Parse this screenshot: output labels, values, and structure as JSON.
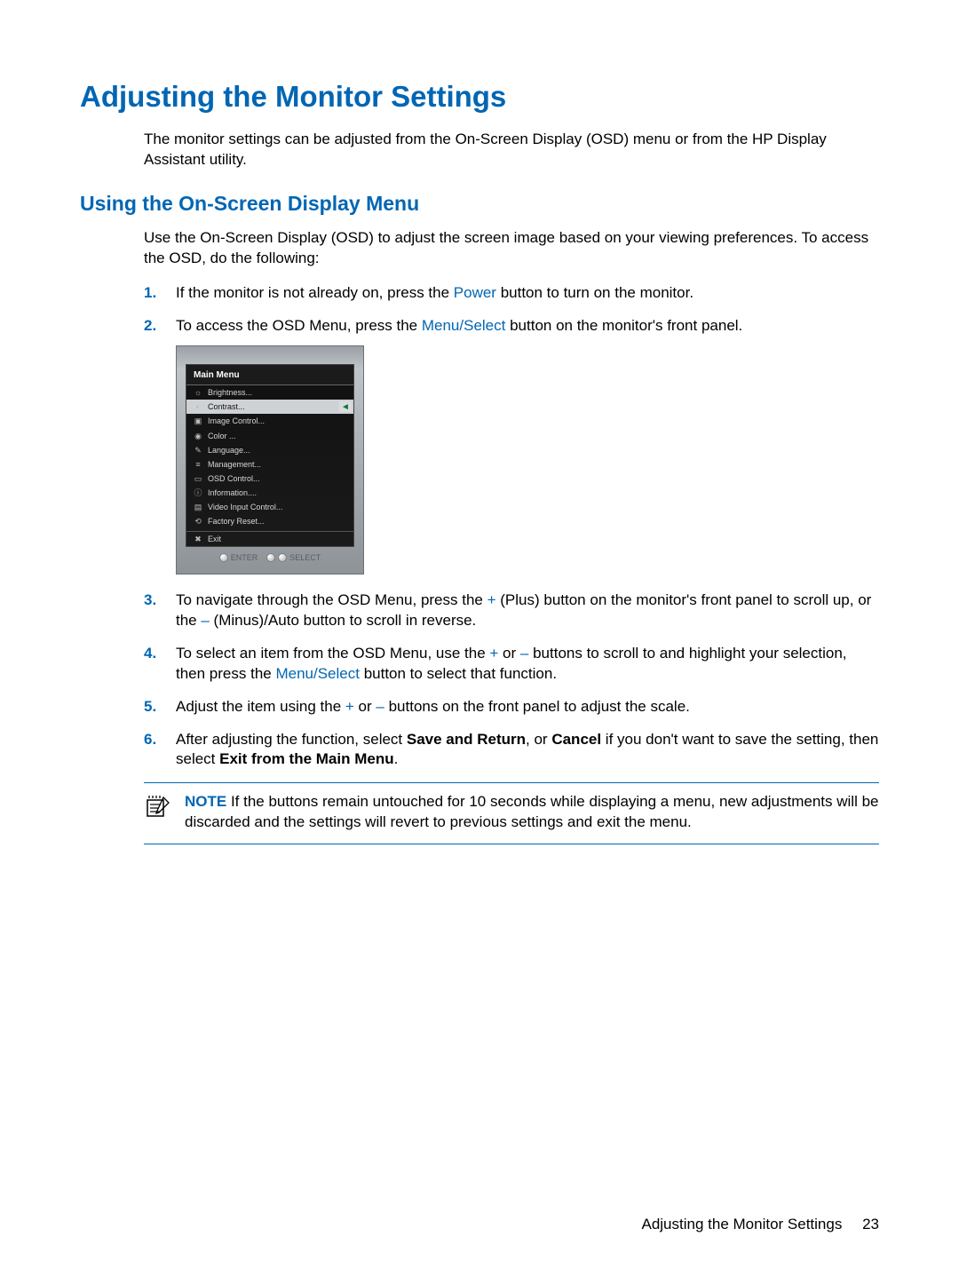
{
  "title": "Adjusting the Monitor Settings",
  "intro": "The monitor settings can be adjusted from the On-Screen Display (OSD) menu or from the HP Display Assistant utility.",
  "subheading": "Using the On-Screen Display Menu",
  "subintro": "Use the On-Screen Display (OSD) to adjust the screen image based on your viewing preferences. To access the OSD, do the following:",
  "steps": {
    "s1": {
      "num": "1.",
      "pre": "If the monitor is not already on, press the ",
      "hl": "Power",
      "post": " button to turn on the monitor."
    },
    "s2": {
      "num": "2.",
      "pre": "To access the OSD Menu, press the ",
      "hl": "Menu/Select",
      "post": " button on the monitor's front panel."
    },
    "s3": {
      "num": "3.",
      "pre": "To navigate through the OSD Menu, press the ",
      "hl1": "+",
      "mid": " (Plus) button on the monitor's front panel to scroll up, or the ",
      "hl2": "–",
      "post": " (Minus)/Auto button to scroll in reverse."
    },
    "s4": {
      "num": "4.",
      "pre": "To select an item from the OSD Menu, use the ",
      "hl1": "+",
      "mid1": " or ",
      "hl2": "–",
      "mid2": " buttons to scroll to and highlight your selection, then press the ",
      "hl3": "Menu/Select",
      "post": " button to select that function."
    },
    "s5": {
      "num": "5.",
      "pre": "Adjust the item using the ",
      "hl1": "+",
      "mid": " or ",
      "hl2": "–",
      "post": " buttons on the front panel to adjust the scale."
    },
    "s6": {
      "num": "6.",
      "pre": "After adjusting the function, select ",
      "b1": "Save and Return",
      "mid1": ", or ",
      "b2": "Cancel",
      "mid2": " if you don't want to save the setting, then select ",
      "b3": "Exit from the Main Menu",
      "post": "."
    }
  },
  "osd": {
    "title": "Main Menu",
    "items": [
      {
        "icon": "☼",
        "label": "Brightness..."
      },
      {
        "icon": "◐",
        "label": "Contrast...",
        "selected": true
      },
      {
        "icon": "▣",
        "label": "Image Control..."
      },
      {
        "icon": "◉",
        "label": "Color ..."
      },
      {
        "icon": "✎",
        "label": "Language..."
      },
      {
        "icon": "≡",
        "label": "Management..."
      },
      {
        "icon": "▭",
        "label": "OSD Control..."
      },
      {
        "icon": "ⓘ",
        "label": "Information...."
      },
      {
        "icon": "▤",
        "label": "Video Input Control..."
      },
      {
        "icon": "⟲",
        "label": "Factory Reset..."
      }
    ],
    "exit": {
      "icon": "✖",
      "label": "Exit"
    },
    "buttons": {
      "enter": "ENTER",
      "select": "SELECT"
    }
  },
  "note": {
    "label": "NOTE",
    "text": "   If the buttons remain untouched for 10 seconds while displaying a menu, new adjustments will be discarded and the settings will revert to previous settings and exit the menu."
  },
  "footer": {
    "text": "Adjusting the Monitor Settings",
    "page": "23"
  }
}
